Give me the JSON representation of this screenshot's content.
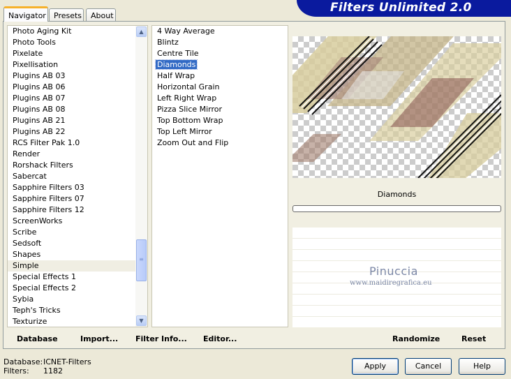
{
  "tabs": [
    {
      "label": "Navigator",
      "active": true
    },
    {
      "label": "Presets",
      "active": false
    },
    {
      "label": "About",
      "active": false
    }
  ],
  "title": "Filters Unlimited 2.0",
  "categories": [
    "Photo Aging Kit",
    "Photo Tools",
    "Pixelate",
    "Pixellisation",
    "Plugins AB 03",
    "Plugins AB 06",
    "Plugins AB 07",
    "Plugins AB 08",
    "Plugins AB 21",
    "Plugins AB 22",
    "RCS Filter Pak 1.0",
    "Render",
    "Rorshack Filters",
    "Sabercat",
    "Sapphire Filters 03",
    "Sapphire Filters 07",
    "Sapphire Filters 12",
    "ScreenWorks",
    "Scribe",
    "Sedsoft",
    "Shapes",
    "Simple",
    "Special Effects 1",
    "Special Effects 2",
    "Sybia",
    "Teph's Tricks",
    "Texturize"
  ],
  "selected_category": "Simple",
  "filters": [
    "4 Way Average",
    "Blintz",
    "Centre Tile",
    "Diamonds",
    "Half Wrap",
    "Horizontal Grain",
    "Left Right Wrap",
    "Pizza Slice Mirror",
    "Top Bottom Wrap",
    "Top Left Mirror",
    "Zoom Out and Flip"
  ],
  "selected_filter": "Diamonds",
  "preview": {
    "filter_name": "Diamonds",
    "watermark_name": "Pinuccia",
    "watermark_url": "www.maidiregrafica.eu",
    "progress": 0
  },
  "toolbar": {
    "database": "Database",
    "import": "Import...",
    "filter_info": "Filter Info...",
    "editor": "Editor...",
    "randomize": "Randomize",
    "reset": "Reset"
  },
  "status": {
    "database_label": "Database:",
    "database_value": "ICNET-Filters",
    "filters_label": "Filters:",
    "filters_value": "1182"
  },
  "buttons": {
    "apply": "Apply",
    "cancel": "Cancel",
    "help": "Help"
  },
  "icons": {
    "scroll_up": "chevron-up-icon",
    "scroll_down": "chevron-down-icon",
    "scroll_grip": "grip-icon"
  },
  "colors": {
    "title_banner": "#0a1a9e",
    "selection": "#316ac5",
    "tab_highlight": "#f6b12a"
  }
}
